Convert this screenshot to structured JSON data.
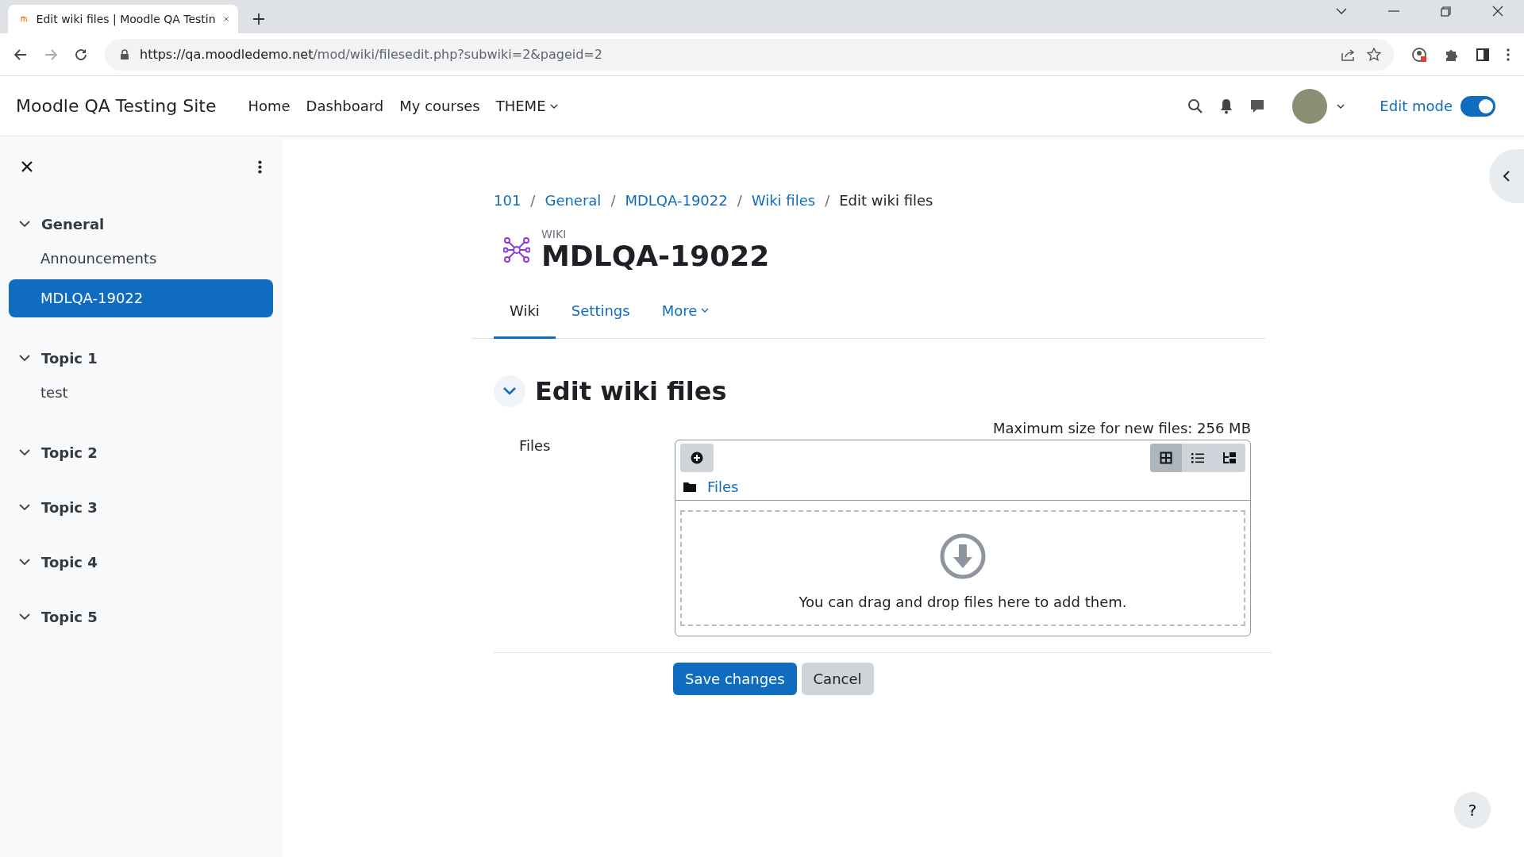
{
  "browser": {
    "tab_title": "Edit wiki files | Moodle QA Testin",
    "url_host": "https://qa.moodledemo.net",
    "url_path": "/mod/wiki/filesedit.php?subwiki=2&pageid=2"
  },
  "navbar": {
    "site_name": "Moodle QA Testing Site",
    "menu": [
      {
        "label": "Home",
        "dropdown": false
      },
      {
        "label": "Dashboard",
        "dropdown": false
      },
      {
        "label": "My courses",
        "dropdown": false
      },
      {
        "label": "THEME",
        "dropdown": true
      }
    ],
    "edit_mode": {
      "label": "Edit mode",
      "on": true
    }
  },
  "sidebar": {
    "sections": [
      {
        "title": "General",
        "expanded": true,
        "children": [
          {
            "label": "Announcements",
            "selected": false
          },
          {
            "label": "MDLQA-19022",
            "selected": true
          }
        ]
      },
      {
        "title": "Topic 1",
        "expanded": true,
        "children": [
          {
            "label": "test",
            "selected": false
          }
        ]
      },
      {
        "title": "Topic 2",
        "expanded": true
      },
      {
        "title": "Topic 3",
        "expanded": true
      },
      {
        "title": "Topic 4",
        "expanded": true
      },
      {
        "title": "Topic 5",
        "expanded": true
      }
    ]
  },
  "breadcrumb": [
    {
      "kind": "link",
      "text": "101"
    },
    {
      "kind": "separator",
      "text": "/"
    },
    {
      "kind": "link",
      "text": "General"
    },
    {
      "kind": "separator",
      "text": "/"
    },
    {
      "kind": "link",
      "text": "MDLQA-19022"
    },
    {
      "kind": "separator",
      "text": "/"
    },
    {
      "kind": "link",
      "text": "Wiki files"
    },
    {
      "kind": "separator",
      "text": "/"
    },
    {
      "kind": "current",
      "text": "Edit wiki files"
    }
  ],
  "header": {
    "type_label": "WIKI",
    "title": "MDLQA-19022"
  },
  "tabs": [
    {
      "label": "Wiki",
      "selected": true,
      "dropdown": false
    },
    {
      "label": "Settings",
      "selected": false,
      "dropdown": false
    },
    {
      "label": "More",
      "selected": false,
      "dropdown": true
    }
  ],
  "section": {
    "title": "Edit wiki files",
    "expanded": true
  },
  "files_field": {
    "label": "Files",
    "max_size": "Maximum size for new files: 256 MB",
    "folder": "Files",
    "drop_hint": "You can drag and drop files here to add them.",
    "views": [
      {
        "kind": "icons",
        "selected": true
      },
      {
        "kind": "list",
        "selected": false
      },
      {
        "kind": "tree",
        "selected": false
      }
    ]
  },
  "buttons": [
    {
      "label": "Save changes",
      "kind": "primary"
    },
    {
      "label": "Cancel",
      "kind": "secondary"
    }
  ],
  "help_button": "?"
}
